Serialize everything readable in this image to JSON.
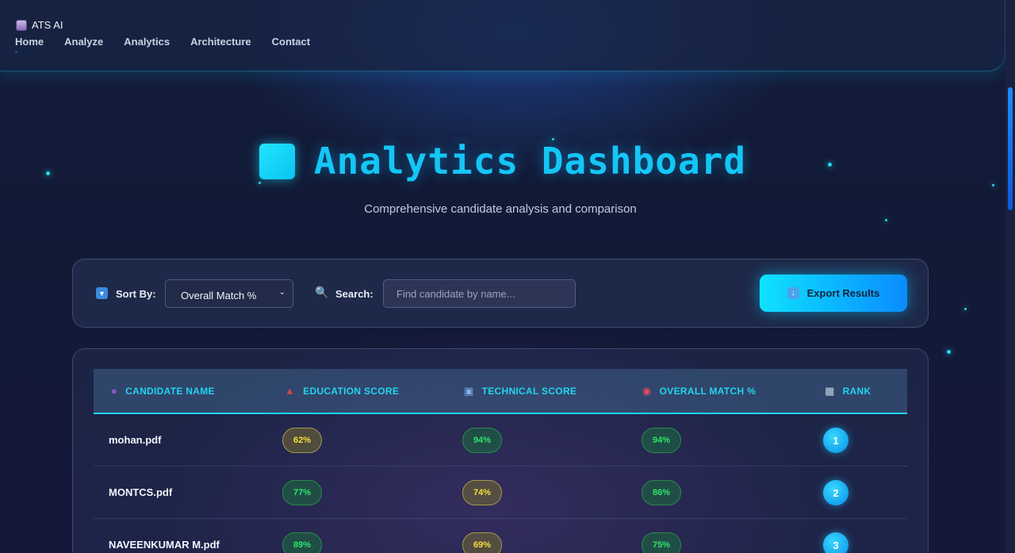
{
  "nav": {
    "brand": "ATS AI",
    "links": [
      "Home",
      "Analyze",
      "Analytics",
      "Architecture",
      "Contact"
    ]
  },
  "hero": {
    "title": "Analytics Dashboard",
    "subtitle": "Comprehensive candidate analysis and comparison"
  },
  "controls": {
    "sort_label": "Sort By:",
    "sort_value": "Overall Match %",
    "search_label": "Search:",
    "search_placeholder": "Find candidate by name...",
    "export_label": "Export Results"
  },
  "table": {
    "headers": [
      "CANDIDATE NAME",
      "EDUCATION SCORE",
      "TECHNICAL SCORE",
      "OVERALL MATCH %",
      "RANK"
    ],
    "rows": [
      {
        "name": "mohan.pdf",
        "education": "62%",
        "technical": "94%",
        "overall": "94%",
        "rank": "1"
      },
      {
        "name": "MONTCS.pdf",
        "education": "77%",
        "technical": "74%",
        "overall": "86%",
        "rank": "2"
      },
      {
        "name": "NAVEENKUMAR M.pdf",
        "education": "89%",
        "technical": "69%",
        "overall": "75%",
        "rank": "3"
      }
    ]
  },
  "colors": {
    "accent": "#14c6f5",
    "score_high": "#2ee66a",
    "score_mid": "#f2e23a"
  }
}
